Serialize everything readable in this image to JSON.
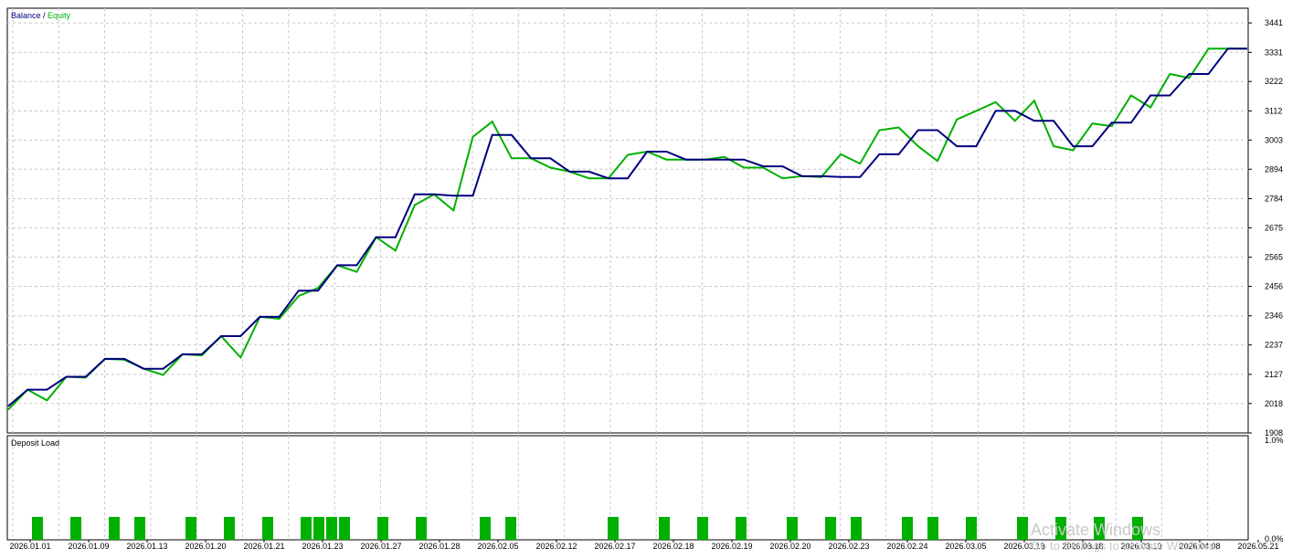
{
  "chart_data": [
    {
      "type": "line",
      "title": "",
      "legend": [
        "Balance",
        "Equity"
      ],
      "legend_separator": " / ",
      "legend_placement": "top-left",
      "grid": true,
      "ylim": [
        1908,
        3496
      ],
      "y_ticks": [
        "3441",
        "3331",
        "3222",
        "3112",
        "3003",
        "2894",
        "2784",
        "2675",
        "2565",
        "2456",
        "2346",
        "2237",
        "2127",
        "2018",
        "1908"
      ],
      "series": [
        {
          "name": "Balance",
          "color": "#00007f",
          "values": [
            2008,
            2070,
            2070,
            2118,
            2118,
            2185,
            2185,
            2148,
            2148,
            2202,
            2202,
            2270,
            2270,
            2342,
            2342,
            2440,
            2440,
            2535,
            2535,
            2640,
            2640,
            2800,
            2800,
            2795,
            2795,
            3022,
            3022,
            2935,
            2935,
            2885,
            2885,
            2860,
            2860,
            2960,
            2960,
            2930,
            2930,
            2930,
            2930,
            2905,
            2905,
            2868,
            2868,
            2865,
            2865,
            2950,
            2950,
            3040,
            3040,
            2980,
            2980,
            3112,
            3112,
            3075,
            3075,
            2980,
            2980,
            3068,
            3068,
            3170,
            3170,
            3250,
            3250,
            3345,
            3345
          ]
        },
        {
          "name": "Equity",
          "color": "#00b000",
          "values": [
            1995,
            2070,
            2030,
            2118,
            2115,
            2185,
            2182,
            2148,
            2125,
            2202,
            2198,
            2270,
            2190,
            2342,
            2335,
            2420,
            2450,
            2535,
            2510,
            2640,
            2590,
            2760,
            2800,
            2740,
            3015,
            3072,
            2935,
            2935,
            2900,
            2885,
            2860,
            2860,
            2948,
            2960,
            2930,
            2930,
            2930,
            2940,
            2900,
            2900,
            2860,
            2868,
            2865,
            2950,
            2915,
            3040,
            3050,
            2980,
            2925,
            3080,
            3112,
            3145,
            3075,
            3150,
            2980,
            2965,
            3065,
            3055,
            3170,
            3125,
            3250,
            3235,
            3345,
            3345,
            3345
          ]
        }
      ]
    },
    {
      "type": "bar",
      "title": "Deposit Load",
      "ylim": [
        0,
        1.0
      ],
      "y_ticks": [
        "1.0%",
        "0.0%"
      ],
      "color": "#00b000",
      "categories": [
        "2026.01.01",
        "2026.01.09",
        "2026.01.13",
        "2026.01.20",
        "2026.01.21",
        "2026.01.23",
        "2026.01.27",
        "2026.01.28",
        "2026.02.05",
        "2026.02.12",
        "2026.02.17",
        "2026.02.18",
        "2026.02.19",
        "2026.02.20",
        "2026.02.23",
        "2026.02.24",
        "2026.03.05",
        "2026.03.13",
        "2026.03.18",
        "2026.03.19",
        "2026.04.08",
        "2026.05.21"
      ],
      "values": [
        0.22,
        0.22,
        0.22,
        0.22,
        0.22,
        0.22,
        0.22,
        0.22,
        0.22,
        0.22,
        0.22,
        0.22,
        0.22,
        0.22,
        0.22,
        0.22,
        0.22,
        0.22,
        0.22,
        0.22,
        0.22,
        0.22,
        0.22,
        0.22,
        0.22,
        0.22,
        0.22,
        0.22,
        0.22,
        0.22,
        0.22,
        0.22,
        0.22,
        0.22,
        0.22,
        0.22,
        0.22,
        0.22,
        0.22
      ]
    }
  ],
  "watermark": {
    "title": "Activate Windows",
    "subtitle": "Go to Settings to activate Windows."
  }
}
